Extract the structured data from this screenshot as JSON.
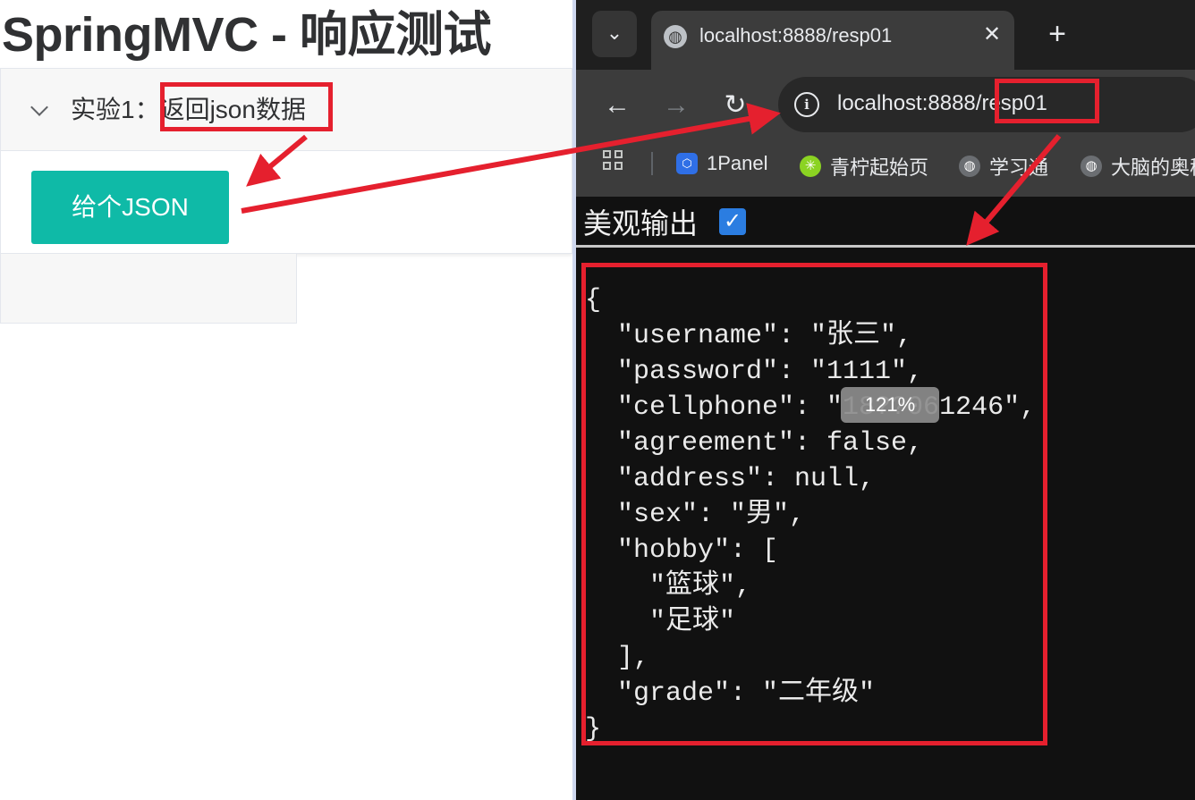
{
  "page": {
    "title": "SpringMVC - 响应测试",
    "experiment_label": "实验1：",
    "experiment_name": "返回json数据",
    "button_label": "给个JSON"
  },
  "browser": {
    "tab_title": "localhost:8888/resp01",
    "tab_close": "✕",
    "new_tab": "+",
    "url_host": "localhost:8888",
    "url_path": "/resp01",
    "bookmarks": [
      {
        "label": "1Panel",
        "icon": "hexagon-icon",
        "color": "#2f6fe6"
      },
      {
        "label": "青柠起始页",
        "icon": "lime-icon",
        "color": "#8bd322"
      },
      {
        "label": "学习通",
        "icon": "globe-icon",
        "color": "#6b6e72"
      },
      {
        "label": "大脑的奥秘",
        "icon": "globe-icon",
        "color": "#6b6e72"
      }
    ],
    "pretty_print_label": "美观输出",
    "zoom_level": "121%",
    "json_lines": [
      "{",
      "  \"username\": \"张三\",",
      "  \"password\": \"1111\",",
      "  \"cellphone\": \"18??061246\",",
      "  \"agreement\": false,",
      "  \"address\": null,",
      "  \"sex\": \"男\",",
      "  \"hobby\": [",
      "    \"篮球\",",
      "    \"足球\"",
      "  ],",
      "  \"grade\": \"二年级\"",
      "}"
    ]
  },
  "colors": {
    "button_teal": "#0fbaa7",
    "annotation_red": "#e5202e",
    "browser_dark": "#111111",
    "checkbox_blue": "#2b7de1"
  }
}
